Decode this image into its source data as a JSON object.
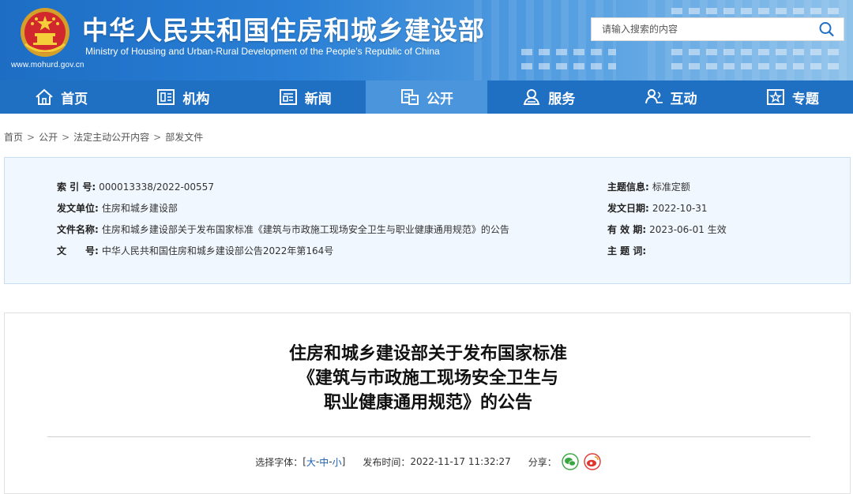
{
  "header": {
    "site_title": "中华人民共和国住房和城乡建设部",
    "site_subtitle": "Ministry of Housing and Urban-Rural Development of the People’s Republic of China",
    "site_url": "www.mohurd.gov.cn",
    "emblem_icon": "national-emblem-icon",
    "search": {
      "placeholder": "请输入搜索的内容",
      "icon": "search-icon"
    }
  },
  "nav": {
    "items": [
      {
        "label": "首页",
        "icon": "home-icon"
      },
      {
        "label": "机构",
        "icon": "organization-icon"
      },
      {
        "label": "新闻",
        "icon": "news-icon"
      },
      {
        "label": "公开",
        "icon": "public-icon",
        "active": true
      },
      {
        "label": "服务",
        "icon": "service-icon"
      },
      {
        "label": "互动",
        "icon": "interact-icon"
      },
      {
        "label": "专题",
        "icon": "topic-icon"
      }
    ],
    "active_color": "#4b95dc",
    "bar_color": "#1f6fc3"
  },
  "breadcrumb": {
    "items": [
      "首页",
      "公开",
      "法定主动公开内容",
      "部发文件"
    ],
    "separator": ">"
  },
  "info": {
    "index_label": "索 引 号:",
    "index_value": "000013338/2022-00557",
    "issuer_label": "发文单位:",
    "issuer_value": "住房和城乡建设部",
    "docname_label": "文件名称:",
    "docname_value": "住房和城乡建设部关于发布国家标准《建筑与市政施工现场安全卫生与职业健康通用规范》的公告",
    "docno_label": "文　　号:",
    "docno_value": "中华人民共和国住房和城乡建设部公告2022年第164号",
    "topic_label": "主题信息:",
    "topic_value": "标准定额",
    "date_label": "发文日期:",
    "date_value": "2022-10-31",
    "validity_label": "有 效 期:",
    "validity_value": "2023-06-01 生效",
    "keywords_label": "主 题 词:",
    "keywords_value": ""
  },
  "article": {
    "title_lines": [
      "住房和城乡建设部关于发布国家标准",
      "《建筑与市政施工现场安全卫生与",
      "职业健康通用规范》的公告"
    ],
    "font_label": "选择字体：",
    "font_open": "[",
    "font_large": "大",
    "font_medium": "中",
    "font_small": "小",
    "font_dash": "-",
    "font_close": "]",
    "publish_label": "发布时间：",
    "publish_time": "2022-11-17 11:32:27",
    "share_label": "分享：",
    "share_icons": [
      "wechat-icon",
      "weibo-icon"
    ]
  }
}
